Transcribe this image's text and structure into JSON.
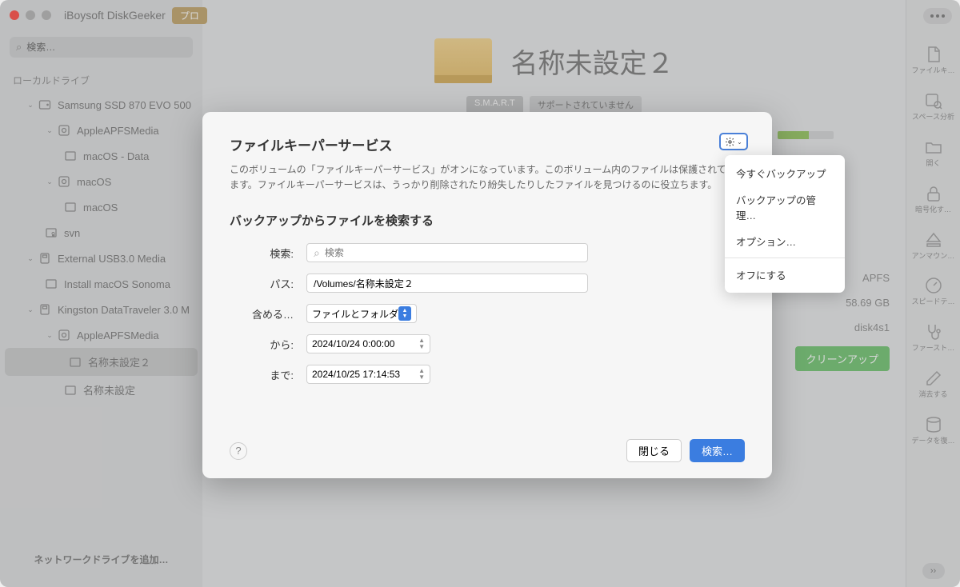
{
  "app": {
    "title": "iBoysoft DiskGeeker",
    "badge": "プロ"
  },
  "sidebar": {
    "search_placeholder": "検索…",
    "section_label": "ローカルドライブ",
    "items": [
      {
        "label": "Samsung SSD 870 EVO 500"
      },
      {
        "label": "AppleAPFSMedia"
      },
      {
        "label": "macOS - Data"
      },
      {
        "label": "macOS"
      },
      {
        "label": "macOS"
      },
      {
        "label": "svn"
      },
      {
        "label": "External USB3.0 Media"
      },
      {
        "label": "Install macOS Sonoma"
      },
      {
        "label": "Kingston DataTraveler 3.0 M"
      },
      {
        "label": "AppleAPFSMedia"
      },
      {
        "label": "名称未設定２"
      },
      {
        "label": "名称未設定"
      }
    ],
    "add_network": "ネットワークドライブを追加…"
  },
  "main": {
    "volume_title": "名称未設定２",
    "smart_label": "S.M.A.R.T",
    "smart_value": "サポートされていません",
    "info": {
      "fs": "APFS",
      "size": "58.69 GB",
      "device": "disk4s1",
      "cleanup": "クリーンアップ"
    }
  },
  "right_toolbar": {
    "items": [
      "ファイルキ…",
      "スペース分析",
      "開く",
      "暗号化す…",
      "アンマウン…",
      "スピードテ…",
      "ファースト…",
      "消去する",
      "データを復…"
    ]
  },
  "modal": {
    "title": "ファイルキーパーサービス",
    "desc": "このボリュームの「ファイルキーパーサービス」がオンになっています。このボリューム内のファイルは保護されています。ファイルキーパーサービスは、うっかり削除されたり紛失したりしたファイルを見つけるのに役立ちます。",
    "section_title": "バックアップからファイルを検索する",
    "labels": {
      "search": "検索:",
      "path": "パス:",
      "include": "含める…",
      "from": "から:",
      "to": "まで:"
    },
    "search_placeholder": "検索",
    "path_value": "/Volumes/名称未設定２",
    "include_value": "ファイルとフォルダ",
    "from_value": "2024/10/24  0:00:00",
    "to_value": "2024/10/25 17:14:53",
    "help": "?",
    "close_btn": "閉じる",
    "search_btn": "検索…"
  },
  "dropdown": {
    "items": [
      "今すぐバックアップ",
      "バックアップの管理…",
      "オプション…"
    ],
    "off": "オフにする"
  }
}
